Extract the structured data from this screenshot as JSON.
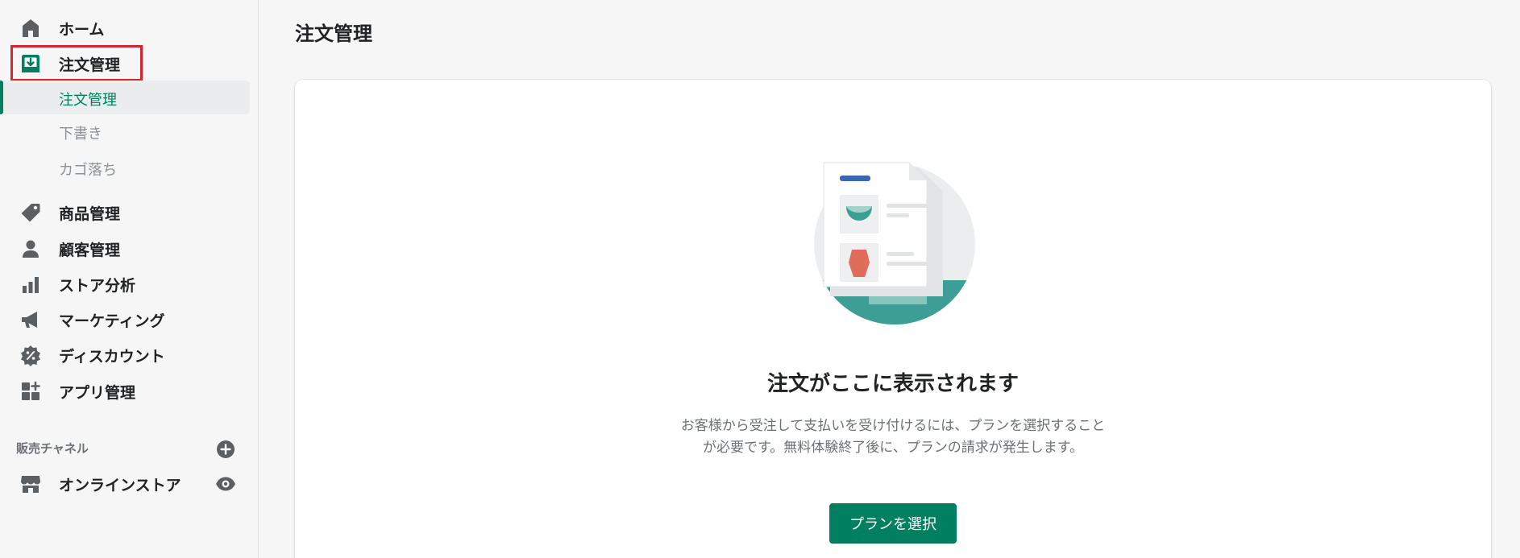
{
  "colors": {
    "accent": "#008060",
    "highlight_border": "#d5232f",
    "sidebar_bg": "#f6f6f7",
    "card_bg": "#ffffff",
    "illustration_teal": "#3d9e96",
    "illustration_red": "#e06c5a",
    "illustration_blue": "#3867b4"
  },
  "sidebar": {
    "items": [
      {
        "label": "ホーム",
        "icon": "home-icon"
      },
      {
        "label": "注文管理",
        "icon": "orders-icon"
      },
      {
        "label": "商品管理",
        "icon": "tag-icon"
      },
      {
        "label": "顧客管理",
        "icon": "person-icon"
      },
      {
        "label": "ストア分析",
        "icon": "bar-chart-icon"
      },
      {
        "label": "マーケティング",
        "icon": "megaphone-icon"
      },
      {
        "label": "ディスカウント",
        "icon": "discount-icon"
      },
      {
        "label": "アプリ管理",
        "icon": "apps-icon"
      }
    ],
    "sub_items": [
      {
        "label": "注文管理",
        "active": true
      },
      {
        "label": "下書き",
        "active": false
      },
      {
        "label": "カゴ落ち",
        "active": false
      }
    ],
    "sales_channels": {
      "label": "販売チャネル",
      "add_icon": "plus-circle-icon",
      "items": [
        {
          "label": "オンラインストア",
          "icon": "store-icon",
          "action_icon": "eye-icon"
        }
      ]
    }
  },
  "main": {
    "title": "注文管理",
    "empty_state": {
      "illustration": "orders-empty-illustration",
      "heading": "注文がここに表示されます",
      "body": "お客様から受注して支払いを受け付けるには、プランを選択することが必要です。無料体験終了後に、プランの請求が発生します。",
      "button_label": "プランを選択"
    }
  }
}
